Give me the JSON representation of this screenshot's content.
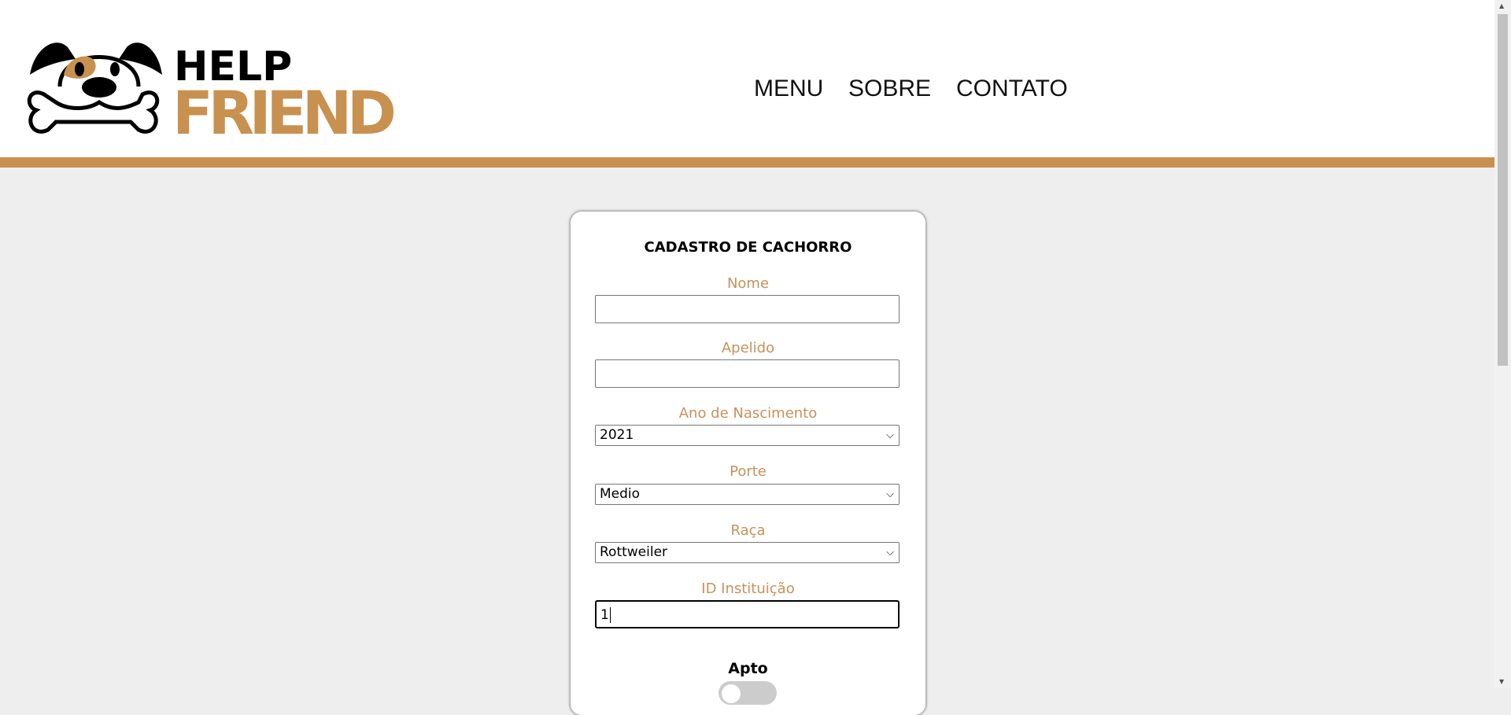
{
  "header": {
    "logo": {
      "line1": "HELP",
      "line2": "FRIEND"
    },
    "nav": [
      "MENU",
      "SOBRE",
      "CONTATO"
    ]
  },
  "colors": {
    "brand": "#c8914f",
    "label": "#c8915a"
  },
  "form": {
    "title": "CADASTRO DE CACHORRO",
    "nome": {
      "label": "Nome",
      "value": ""
    },
    "apelido": {
      "label": "Apelido",
      "value": ""
    },
    "ano": {
      "label": "Ano de Nascimento",
      "value": "2021"
    },
    "porte": {
      "label": "Porte",
      "value": "Medio"
    },
    "raca": {
      "label": "Raça",
      "value": "Rottweiler"
    },
    "instituicao": {
      "label": "ID Instituição",
      "value": "1"
    },
    "apto": {
      "label": "Apto",
      "checked": false
    }
  }
}
